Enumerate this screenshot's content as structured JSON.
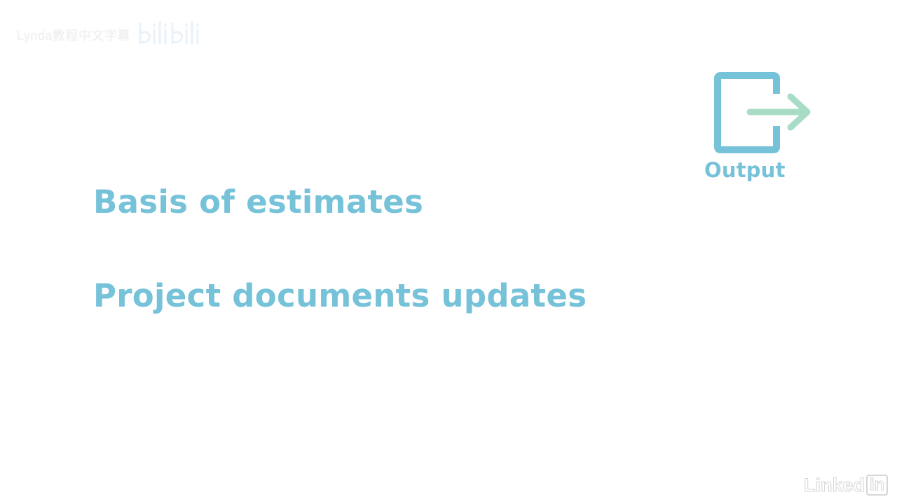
{
  "watermark": {
    "text": "Lynda教程中文字幕",
    "icon": "bilibili-logo"
  },
  "output": {
    "icon": "output-icon",
    "label": "Output",
    "frame_color": "#76c2d9",
    "arrow_color": "#a8dcc6"
  },
  "items": [
    {
      "label": "Basis of estimates"
    },
    {
      "label": "Project documents updates"
    }
  ],
  "linkedin": {
    "word": "Linked",
    "box": "in"
  },
  "colors": {
    "text": "#76c2d9",
    "background": "#ffffff"
  }
}
